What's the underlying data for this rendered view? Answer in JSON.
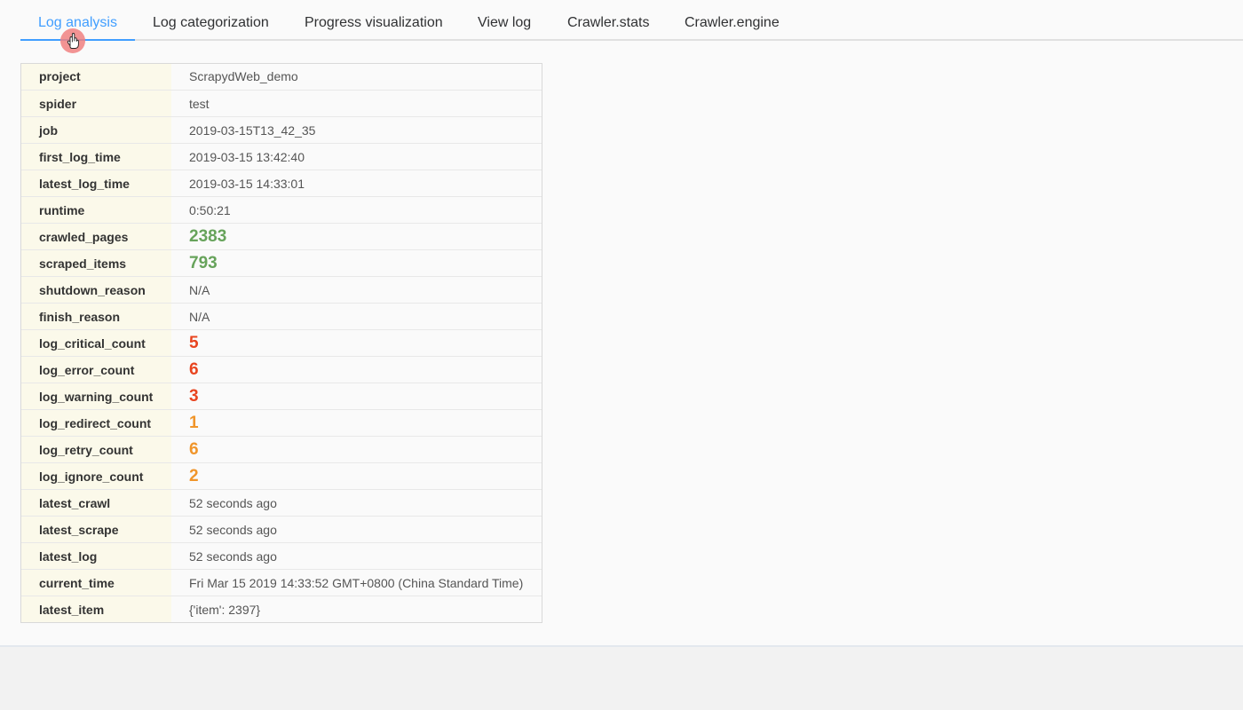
{
  "tabs": [
    {
      "label": "Log analysis",
      "active": true
    },
    {
      "label": "Log categorization",
      "active": false
    },
    {
      "label": "Progress visualization",
      "active": false
    },
    {
      "label": "View log",
      "active": false
    },
    {
      "label": "Crawler.stats",
      "active": false
    },
    {
      "label": "Crawler.engine",
      "active": false
    }
  ],
  "colors": {
    "accent": "#409eff",
    "success": "#67a35b",
    "danger": "#e8441f",
    "warning": "#f0952a",
    "key_bg": "#fbf9ea",
    "cursor": "#f08080"
  },
  "cursor_icon": "hand-pointer-icon",
  "stats": [
    {
      "key": "project",
      "value": "ScrapydWeb_demo",
      "style": "normal"
    },
    {
      "key": "spider",
      "value": "test",
      "style": "normal"
    },
    {
      "key": "job",
      "value": "2019-03-15T13_42_35",
      "style": "normal"
    },
    {
      "key": "first_log_time",
      "value": "2019-03-15 13:42:40",
      "style": "normal"
    },
    {
      "key": "latest_log_time",
      "value": "2019-03-15 14:33:01",
      "style": "normal"
    },
    {
      "key": "runtime",
      "value": "0:50:21",
      "style": "normal"
    },
    {
      "key": "crawled_pages",
      "value": "2383",
      "style": "big-green"
    },
    {
      "key": "scraped_items",
      "value": "793",
      "style": "big-green"
    },
    {
      "key": "shutdown_reason",
      "value": "N/A",
      "style": "normal"
    },
    {
      "key": "finish_reason",
      "value": "N/A",
      "style": "normal"
    },
    {
      "key": "log_critical_count",
      "value": "5",
      "style": "big-red"
    },
    {
      "key": "log_error_count",
      "value": "6",
      "style": "big-red"
    },
    {
      "key": "log_warning_count",
      "value": "3",
      "style": "big-red"
    },
    {
      "key": "log_redirect_count",
      "value": "1",
      "style": "big-orange"
    },
    {
      "key": "log_retry_count",
      "value": "6",
      "style": "big-orange"
    },
    {
      "key": "log_ignore_count",
      "value": "2",
      "style": "big-orange"
    },
    {
      "key": "latest_crawl",
      "value": "52 seconds ago",
      "style": "normal"
    },
    {
      "key": "latest_scrape",
      "value": "52 seconds ago",
      "style": "normal"
    },
    {
      "key": "latest_log",
      "value": "52 seconds ago",
      "style": "normal"
    },
    {
      "key": "current_time",
      "value": "Fri Mar 15 2019 14:33:52 GMT+0800 (China Standard Time)",
      "style": "normal"
    },
    {
      "key": "latest_item",
      "value": "{'item': 2397}",
      "style": "normal"
    }
  ]
}
